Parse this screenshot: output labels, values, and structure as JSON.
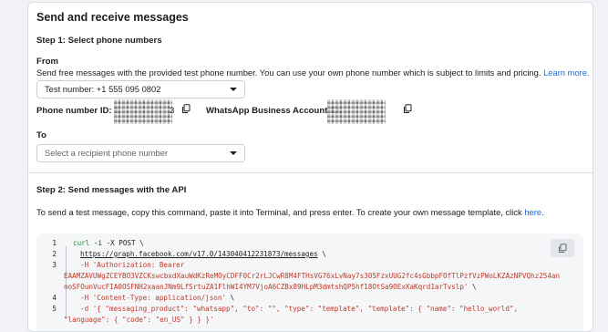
{
  "title": "Send and receive messages",
  "step1": {
    "heading": "Step 1: Select phone numbers",
    "from_label": "From",
    "from_desc": "Send free messages with the provided test phone number. You can use your own phone number which is subject to limits and pricing.",
    "learn_more": "Learn more.",
    "from_select_value": "Test number: +1 555 095 0802",
    "phone_id_label": "Phone number ID: 1",
    "phone_id_tail": "3",
    "waba_label": "WhatsApp Business Account ID:",
    "to_label": "To",
    "to_placeholder": "Select a recipient phone number"
  },
  "step2": {
    "heading": "Step 2: Send messages with the API",
    "desc": "To send a test message, copy this command, paste it into Terminal, and press enter. To create your own message template, click",
    "here_link": "here",
    "desc_end": "."
  },
  "code": {
    "l1_num": "1",
    "l1_cmd": "curl",
    "l1_rest": " -i -X POST \\",
    "l2_num": "2",
    "l2_a": "https://graph.facebook.com/v17.",
    "l2_b": "0",
    "l2_c": "/",
    "l2_d": "143040412231873",
    "l2_e": "/messages",
    "l2_f": " \\",
    "l3_num": "3",
    "l3_a": "-H 'Authorization: Bearer",
    "l3_b": "EAAMZAVUWgZCEYBO3VZCKswcbxdXauWdKzReMOyCDFF0Cr2rLJCwR8M4FTHsVG76xLvNay7s305FzxUUG2fc4sGbbpFOfTlPzfVzPWoLKZAzNPVQhz254an",
    "l3_c": "noSFOunVucFIA0OSFNH2xaanJNm9LfSrtuZA1FlhWI4YM7VjoA6CZBx89HLpM3dmtshQP5hf18OtSa9OExXaKqrd1arTvslp'",
    "l3_d": " \\",
    "l4_num": "4",
    "l4_a": "-H 'Content-Type: application/json'",
    "l4_b": " \\",
    "l5_num": "5",
    "l5_a": "-d '{ \"messaging_product\": \"whatsapp\", \"to\": \"\", \"type\": \"template\", \"template\": { \"name\": \"hello_world\",",
    "l5_b": "\"language\": { \"code\": \"en_US\" } } }'"
  },
  "icons": {
    "copy": "copy-icon",
    "caret": "caret-down-icon"
  },
  "colors": {
    "link": "#1a6ed8",
    "code_green": "#1c8a3e",
    "code_red": "#c0392b"
  }
}
